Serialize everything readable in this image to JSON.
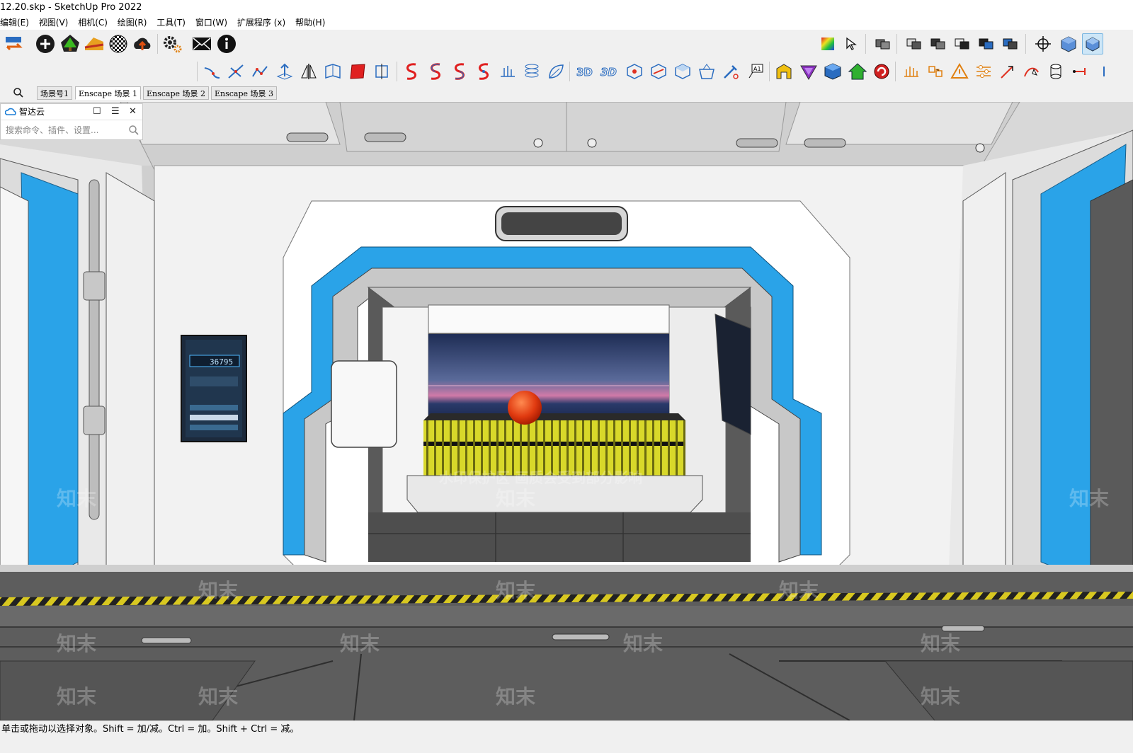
{
  "window": {
    "title": "12.20.skp - SketchUp Pro 2022"
  },
  "menu": [
    "编辑(E)",
    "视图(V)",
    "相机(C)",
    "绘图(R)",
    "工具(T)",
    "窗口(W)",
    "扩展程序 (x)",
    "帮助(H)"
  ],
  "toolbar": {
    "row1_left": [
      "transfer-arrows-icon",
      "add-circle-icon",
      "tree-icon",
      "sandbox-icon",
      "checker-icon",
      "cloud-upload-icon",
      "gear-icon",
      "mail-icon",
      "info-icon"
    ],
    "row1_right": [
      "color-cube-icon",
      "select-cursor-icon",
      "group-icon",
      "solid-union-icon",
      "solid-subtract-icon",
      "solid-intersect-icon",
      "solid-trim-icon",
      "solid-split-icon",
      "orbit-icon",
      "iso-view-icon",
      "perspective-view-icon"
    ],
    "row2": [
      "line-tool-icon",
      "bisect-icon",
      "polyline-icon",
      "pushpull-icon",
      "mirror-icon",
      "fold-icon",
      "red-face-icon",
      "flip-icon",
      "spring-red-1-icon",
      "spring-red-2-icon",
      "spring-red-3-icon",
      "spring-red-4-icon",
      "weld-icon",
      "coil-icon",
      "leaf-icon",
      "3d-text-1-icon",
      "3d-text-2-icon",
      "box-1-icon",
      "box-2-icon",
      "box-3-icon",
      "basket-icon",
      "pipette-icon",
      "label-icon",
      "yellow-shape-icon",
      "purple-shape-icon",
      "blue-cube-icon",
      "green-house-icon",
      "red-rotate-icon",
      "grid-icon",
      "connect-icon",
      "warning-icon",
      "sliders-icon",
      "pointer-icon",
      "curve-pointer-icon",
      "cylinder-icon",
      "dimension-icon"
    ]
  },
  "scenes": {
    "search_icon": "search-icon",
    "tabs": [
      {
        "label": "场景号1",
        "active": false
      },
      {
        "label": "Enscape 场景 1",
        "active": true
      },
      {
        "label": "Enscape 场景 2",
        "active": false
      },
      {
        "label": "Enscape 场景 3",
        "active": false
      }
    ]
  },
  "panel": {
    "title": "智达云",
    "search_placeholder": "搜索命令、插件、设置..."
  },
  "viewport": {
    "screen_number": "36795",
    "watermark_text": "知末",
    "watermark_notice": "水印保护区 画质会受到部分影响"
  },
  "status": {
    "hint": "单击或拖动以选择对象。Shift = 加/减。Ctrl = 加。Shift + Ctrl = 减。"
  },
  "colors": {
    "accent_blue": "#2aa3e8",
    "sphere": "#e03a10",
    "hazard_yellow": "#d8d020"
  }
}
